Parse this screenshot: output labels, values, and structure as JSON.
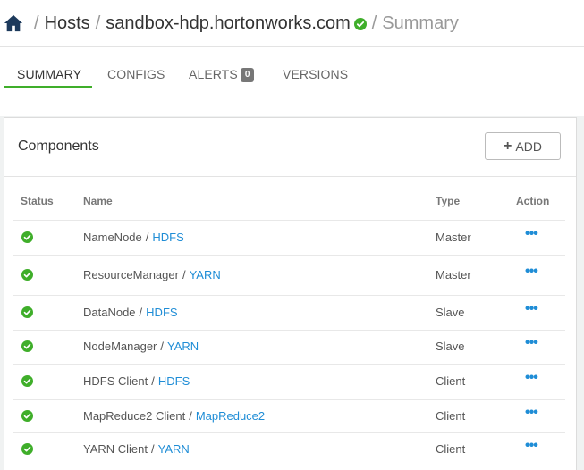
{
  "breadcrumb": {
    "hosts": "Hosts",
    "host": "sandbox-hdp.hortonworks.com",
    "current": "Summary",
    "separator": "/"
  },
  "tabs": [
    {
      "label": "SUMMARY",
      "active": true
    },
    {
      "label": "CONFIGS",
      "active": false
    },
    {
      "label": "ALERTS",
      "active": false,
      "badge": "0"
    },
    {
      "label": "VERSIONS",
      "active": false
    }
  ],
  "components": {
    "title": "Components",
    "add_label": "ADD",
    "columns": {
      "status": "Status",
      "name": "Name",
      "type": "Type",
      "action": "Action"
    },
    "rows": [
      {
        "name": "NameNode",
        "service": "HDFS",
        "type": "Master",
        "status": "ok"
      },
      {
        "name": "ResourceManager",
        "service": "YARN",
        "type": "Master",
        "status": "ok"
      },
      {
        "name": "DataNode",
        "service": "HDFS",
        "type": "Slave",
        "status": "ok"
      },
      {
        "name": "NodeManager",
        "service": "YARN",
        "type": "Slave",
        "status": "ok"
      },
      {
        "name": "HDFS Client",
        "service": "HDFS",
        "type": "Client",
        "status": "ok"
      },
      {
        "name": "MapReduce2 Client",
        "service": "MapReduce2",
        "type": "Client",
        "status": "ok"
      },
      {
        "name": "YARN Client",
        "service": "YARN",
        "type": "Client",
        "status": "ok"
      }
    ],
    "action_glyph": "•••"
  },
  "colors": {
    "accent": "#3fae2a",
    "link": "#1f8dd6",
    "status_ok": "#3fae2a"
  }
}
